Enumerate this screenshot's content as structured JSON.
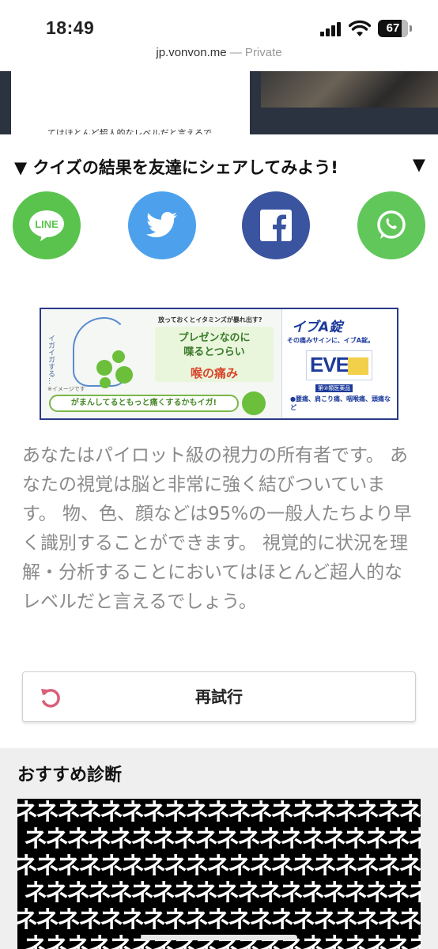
{
  "status_bar": {
    "time": "18:49",
    "battery": "67"
  },
  "browser": {
    "domain": "jp.vonvon.me",
    "mode": "— Private"
  },
  "top_card": {
    "text_partial": "てはほとんど超人的なレベルだと言えるでしょう。"
  },
  "share": {
    "heading": "▼ クイズの結果を友達にシェアしてみよう!",
    "heading_arrow": "▼",
    "buttons": [
      {
        "label": "LINE",
        "color": "#5ac34e"
      },
      {
        "label": "twitter",
        "color": "#4da1ec"
      },
      {
        "label": "facebook",
        "color": "#3b54a0"
      },
      {
        "label": "whatsapp",
        "color": "#61c75b"
      }
    ]
  },
  "ad": {
    "top_text": "放っておくとイタミンズが暴れ出す?",
    "center_line1": "プレゼンなのに",
    "center_line2": "喋るとつらい",
    "center_line3": "喉の痛み",
    "side_text": "イガイガする…",
    "note": "※イメージです",
    "bottom_text": "がまんしてるともっと痛くするかもイガ!",
    "brand": "イブA錠",
    "sub": "その痛みサインに、イブA錠。",
    "product": "EVE",
    "tag": "第②類医薬品",
    "list": "●腰痛、肩こり痛、咽喉痛、頭痛など"
  },
  "result": {
    "description": "あなたはパイロット級の視力の所有者です。 あなたの視覚は脳と非常に強く結びついています。 物、色、顔などは95%の一般人たちより早く識別することができます。 視覚的に状況を理解・分析することにおいてはほとんど超人的なレベルだと言えるでしょう。"
  },
  "retry": {
    "label": "再試行"
  },
  "recommend": {
    "title": "おすすめ診断",
    "pattern_text": "ネネネネネネネネネネネネネネネネネネネネ"
  }
}
